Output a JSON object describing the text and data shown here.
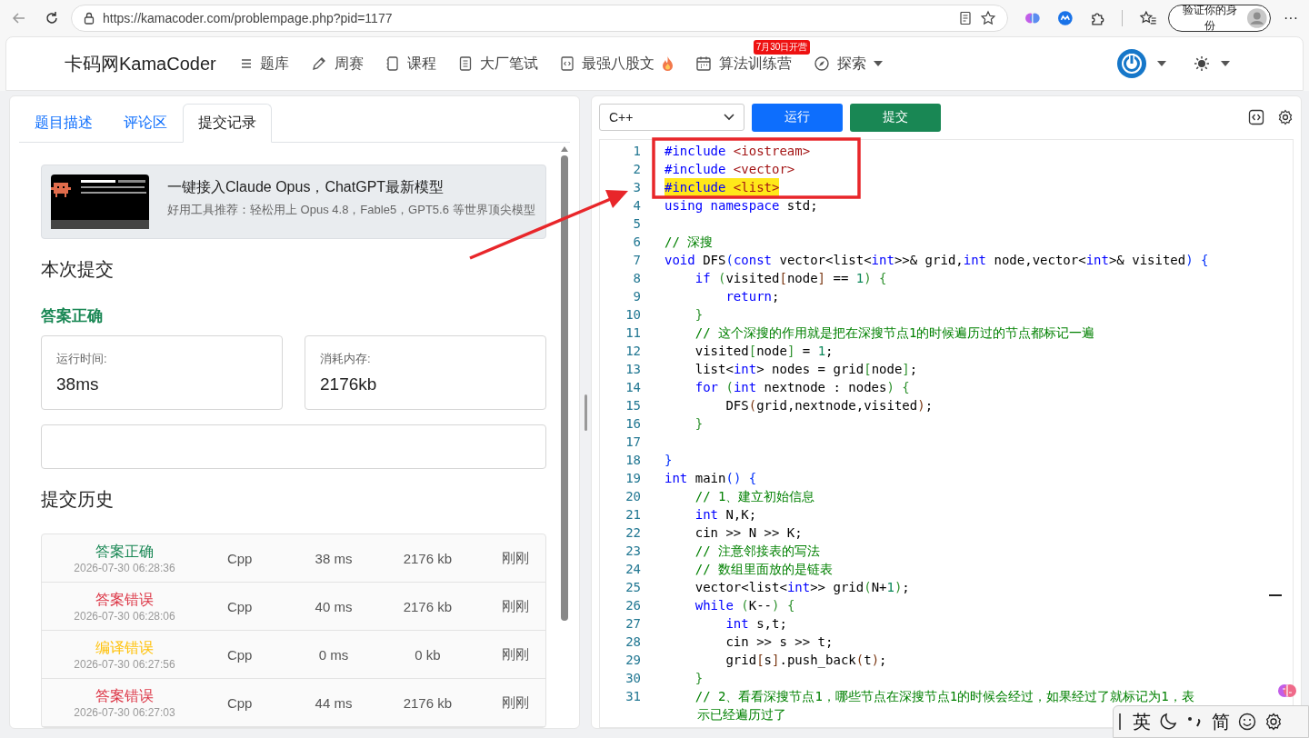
{
  "browser": {
    "url": "https://kamacoder.com/problempage.php?pid=1177",
    "profile_label": "验证你的身份",
    "more": "···"
  },
  "nav": {
    "brand": "卡码网KamaCoder",
    "items": [
      {
        "label": "题库",
        "kind": "list"
      },
      {
        "label": "周赛",
        "kind": "pencil"
      },
      {
        "label": "课程",
        "kind": "book"
      },
      {
        "label": "大厂笔试",
        "kind": "notes"
      },
      {
        "label": "最强八股文",
        "kind": "code",
        "flame": true
      },
      {
        "label": "算法训练营",
        "kind": "calendar",
        "badge": "7月30日开营"
      },
      {
        "label": "探索",
        "kind": "compass",
        "dropdown": true
      }
    ]
  },
  "left": {
    "tabs": [
      {
        "label": "题目描述",
        "selected": false
      },
      {
        "label": "评论区",
        "selected": false
      },
      {
        "label": "提交记录",
        "selected": true
      }
    ],
    "ad": {
      "title": "一键接入Claude Opus，ChatGPT最新模型",
      "subtitle": "好用工具推荐：轻松用上 Opus 4.8，Fable5，GPT5.6 等世界顶尖模型"
    },
    "current_title": "本次提交",
    "current": {
      "status": "答案正确",
      "kind": "accepted"
    },
    "stats": [
      {
        "label": "运行时间:",
        "value": "38ms"
      },
      {
        "label": "消耗内存:",
        "value": "2176kb"
      }
    ],
    "history_title": "提交历史",
    "history": [
      {
        "status": "答案正确",
        "kind": "accepted",
        "time": "2026-07-30 06:28:36",
        "lang": "Cpp",
        "runtime": "38 ms",
        "memory": "2176 kb",
        "when": "刚刚"
      },
      {
        "status": "答案错误",
        "kind": "wrong",
        "time": "2026-07-30 06:28:06",
        "lang": "Cpp",
        "runtime": "40 ms",
        "memory": "2176 kb",
        "when": "刚刚"
      },
      {
        "status": "编译错误",
        "kind": "compile_error",
        "time": "2026-07-30 06:27:56",
        "lang": "Cpp",
        "runtime": "0 ms",
        "memory": "0 kb",
        "when": "刚刚"
      },
      {
        "status": "答案错误",
        "kind": "wrong",
        "time": "2026-07-30 06:27:03",
        "lang": "Cpp",
        "runtime": "44 ms",
        "memory": "2176 kb",
        "when": "刚刚"
      }
    ]
  },
  "editor": {
    "language": "C++",
    "run_label": "运行",
    "submit_label": "提交",
    "lines": [
      {
        "n": "1",
        "tokens": [
          {
            "kind": "keyword",
            "text": "#include "
          },
          {
            "kind": "string",
            "text": "<iostream>"
          }
        ]
      },
      {
        "n": "2",
        "tokens": [
          {
            "kind": "keyword",
            "text": "#include "
          },
          {
            "kind": "string",
            "text": "<vector>"
          }
        ]
      },
      {
        "n": "3",
        "highlighted": true,
        "tokens": [
          {
            "kind": "keyword",
            "text": "#include "
          },
          {
            "kind": "string",
            "text": "<list>"
          }
        ]
      },
      {
        "n": "4",
        "tokens": [
          {
            "kind": "keyword",
            "text": "using namespace"
          },
          {
            "kind": "plain",
            "text": " std;"
          }
        ]
      },
      {
        "n": "5"
      },
      {
        "n": "6",
        "tokens": [
          {
            "kind": "comment",
            "text": "// 深搜"
          }
        ]
      },
      {
        "n": "7",
        "tokens": [
          {
            "kind": "keyword",
            "text": "void"
          },
          {
            "kind": "plain",
            "text": " DFS"
          },
          {
            "kind": "bracket1",
            "text": "("
          },
          {
            "kind": "keyword",
            "text": "const"
          },
          {
            "kind": "plain",
            "text": " vector<list<"
          },
          {
            "kind": "keyword",
            "text": "int"
          },
          {
            "kind": "plain",
            "text": ">>& grid,"
          },
          {
            "kind": "keyword",
            "text": "int"
          },
          {
            "kind": "plain",
            "text": " node,vector<"
          },
          {
            "kind": "keyword",
            "text": "int"
          },
          {
            "kind": "plain",
            "text": ">& visited"
          },
          {
            "kind": "bracket1",
            "text": ") {"
          }
        ]
      },
      {
        "n": "8",
        "tokens": [
          {
            "kind": "keyword",
            "text": "    if"
          },
          {
            "kind": "bracket2",
            "text": " ("
          },
          {
            "kind": "plain",
            "text": "visited"
          },
          {
            "kind": "bracket3",
            "text": "["
          },
          {
            "kind": "plain",
            "text": "node"
          },
          {
            "kind": "bracket3",
            "text": "]"
          },
          {
            "kind": "plain",
            "text": " == "
          },
          {
            "kind": "number",
            "text": "1"
          },
          {
            "kind": "bracket2",
            "text": ") {"
          }
        ]
      },
      {
        "n": "9",
        "tokens": [
          {
            "kind": "keyword",
            "text": "        return"
          },
          {
            "kind": "plain",
            "text": ";"
          }
        ]
      },
      {
        "n": "10",
        "tokens": [
          {
            "kind": "bracket2",
            "text": "    }"
          }
        ]
      },
      {
        "n": "11",
        "tokens": [
          {
            "kind": "comment",
            "text": "    // 这个深搜的作用就是把在深搜节点1的时候遍历过的节点都标记一遍"
          }
        ]
      },
      {
        "n": "12",
        "tokens": [
          {
            "kind": "plain",
            "text": "    visited"
          },
          {
            "kind": "bracket2",
            "text": "["
          },
          {
            "kind": "plain",
            "text": "node"
          },
          {
            "kind": "bracket2",
            "text": "]"
          },
          {
            "kind": "plain",
            "text": " = "
          },
          {
            "kind": "number",
            "text": "1"
          },
          {
            "kind": "plain",
            "text": ";"
          }
        ]
      },
      {
        "n": "13",
        "tokens": [
          {
            "kind": "plain",
            "text": "    list<"
          },
          {
            "kind": "keyword",
            "text": "int"
          },
          {
            "kind": "plain",
            "text": "> nodes = grid"
          },
          {
            "kind": "bracket2",
            "text": "["
          },
          {
            "kind": "plain",
            "text": "node"
          },
          {
            "kind": "bracket2",
            "text": "]"
          },
          {
            "kind": "plain",
            "text": ";"
          }
        ]
      },
      {
        "n": "14",
        "tokens": [
          {
            "kind": "keyword",
            "text": "    for"
          },
          {
            "kind": "bracket2",
            "text": " ("
          },
          {
            "kind": "keyword",
            "text": "int"
          },
          {
            "kind": "plain",
            "text": " nextnode : nodes"
          },
          {
            "kind": "bracket2",
            "text": ") {"
          }
        ]
      },
      {
        "n": "15",
        "tokens": [
          {
            "kind": "plain",
            "text": "        DFS"
          },
          {
            "kind": "bracket3",
            "text": "("
          },
          {
            "kind": "plain",
            "text": "grid,nextnode,visited"
          },
          {
            "kind": "bracket3",
            "text": ")"
          },
          {
            "kind": "plain",
            "text": ";"
          }
        ]
      },
      {
        "n": "16",
        "tokens": [
          {
            "kind": "bracket2",
            "text": "    }"
          }
        ]
      },
      {
        "n": "17"
      },
      {
        "n": "18",
        "tokens": [
          {
            "kind": "bracket1",
            "text": "}"
          }
        ]
      },
      {
        "n": "19",
        "tokens": [
          {
            "kind": "keyword",
            "text": "int"
          },
          {
            "kind": "plain",
            "text": " main"
          },
          {
            "kind": "bracket1",
            "text": "() {"
          }
        ]
      },
      {
        "n": "20",
        "tokens": [
          {
            "kind": "comment",
            "text": "    // 1、建立初始信息"
          }
        ]
      },
      {
        "n": "21",
        "tokens": [
          {
            "kind": "keyword",
            "text": "    int"
          },
          {
            "kind": "plain",
            "text": " N,K;"
          }
        ]
      },
      {
        "n": "22",
        "tokens": [
          {
            "kind": "plain",
            "text": "    cin >> N >> K;"
          }
        ]
      },
      {
        "n": "23",
        "tokens": [
          {
            "kind": "comment",
            "text": "    // 注意邻接表的写法"
          }
        ]
      },
      {
        "n": "24",
        "tokens": [
          {
            "kind": "comment",
            "text": "    // 数组里面放的是链表"
          }
        ]
      },
      {
        "n": "25",
        "tokens": [
          {
            "kind": "plain",
            "text": "    vector<list<"
          },
          {
            "kind": "keyword",
            "text": "int"
          },
          {
            "kind": "plain",
            "text": ">> grid"
          },
          {
            "kind": "bracket2",
            "text": "("
          },
          {
            "kind": "plain",
            "text": "N+"
          },
          {
            "kind": "number",
            "text": "1"
          },
          {
            "kind": "bracket2",
            "text": ")"
          },
          {
            "kind": "plain",
            "text": ";"
          }
        ]
      },
      {
        "n": "26",
        "tokens": [
          {
            "kind": "keyword",
            "text": "    while"
          },
          {
            "kind": "bracket2",
            "text": " ("
          },
          {
            "kind": "plain",
            "text": "K--"
          },
          {
            "kind": "bracket2",
            "text": ") {"
          }
        ]
      },
      {
        "n": "27",
        "tokens": [
          {
            "kind": "keyword",
            "text": "        int"
          },
          {
            "kind": "plain",
            "text": " s,t;"
          }
        ]
      },
      {
        "n": "28",
        "tokens": [
          {
            "kind": "plain",
            "text": "        cin >> s >> t;"
          }
        ]
      },
      {
        "n": "29",
        "tokens": [
          {
            "kind": "plain",
            "text": "        grid"
          },
          {
            "kind": "bracket3",
            "text": "["
          },
          {
            "kind": "plain",
            "text": "s"
          },
          {
            "kind": "bracket3",
            "text": "]"
          },
          {
            "kind": "plain",
            "text": ".push_back"
          },
          {
            "kind": "bracket3",
            "text": "("
          },
          {
            "kind": "plain",
            "text": "t"
          },
          {
            "kind": "bracket3",
            "text": ")"
          },
          {
            "kind": "plain",
            "text": ";"
          }
        ]
      },
      {
        "n": "30",
        "tokens": [
          {
            "kind": "bracket2",
            "text": "    }"
          }
        ]
      },
      {
        "n": "31",
        "tokens": [
          {
            "kind": "comment",
            "text": "    // 2、看看深搜节点1，哪些节点在深搜节点1的时候会经过，如果经过了就标记为1，表"
          }
        ]
      },
      {
        "continuation": true,
        "tokens": [
          {
            "kind": "comment",
            "text": "示已经遍历过了"
          }
        ]
      }
    ]
  },
  "ime": {
    "items": [
      "英",
      "简"
    ]
  }
}
